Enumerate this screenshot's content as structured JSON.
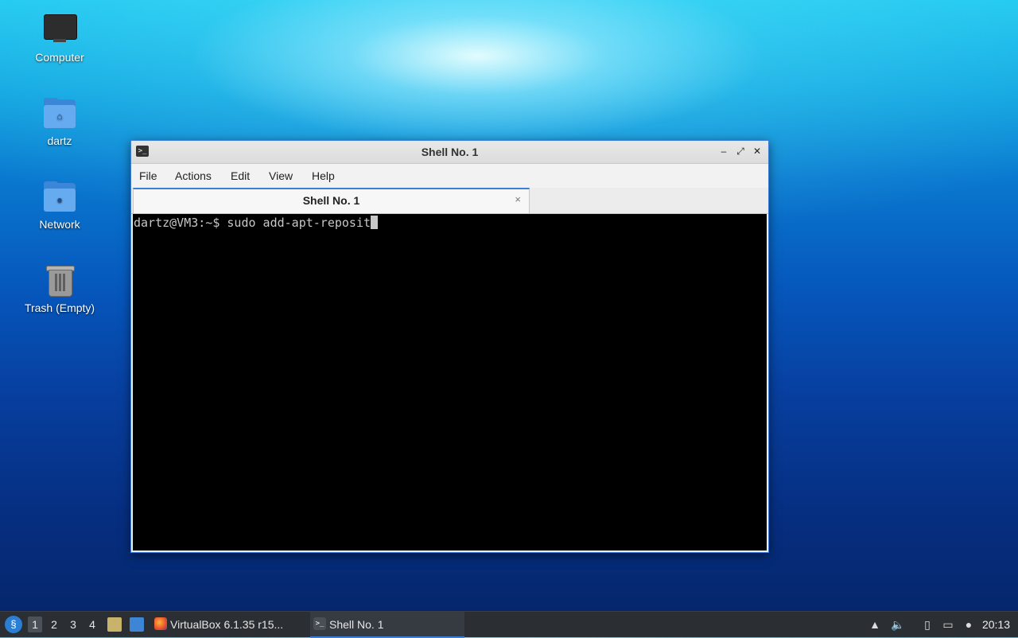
{
  "desktop": {
    "icons": [
      {
        "label": "Computer",
        "icon": "computer-icon"
      },
      {
        "label": "dartz",
        "icon": "home-folder-icon"
      },
      {
        "label": "Network",
        "icon": "network-folder-icon"
      },
      {
        "label": "Trash (Empty)",
        "icon": "trash-icon"
      }
    ]
  },
  "window": {
    "title": "Shell No. 1",
    "menu": [
      "File",
      "Actions",
      "Edit",
      "View",
      "Help"
    ],
    "tab": {
      "label": "Shell No. 1",
      "close": "×"
    },
    "terminal": {
      "prompt": "dartz@VM3:~$ ",
      "command": "sudo add-apt-reposit"
    },
    "controls": {
      "minimize": "–",
      "maximize": "⤢",
      "close": "✕"
    }
  },
  "taskbar": {
    "workspaces": [
      "1",
      "2",
      "3",
      "4"
    ],
    "active_workspace": "1",
    "tasks": [
      {
        "label": "VirtualBox 6.1.35 r15...",
        "icon": "firefox-icon"
      },
      {
        "label": "Shell No. 1",
        "icon": "terminal-icon"
      }
    ],
    "clock": "20:13",
    "colors": {
      "accent": "#3d7fd6",
      "panel": "#2b2f34"
    }
  }
}
